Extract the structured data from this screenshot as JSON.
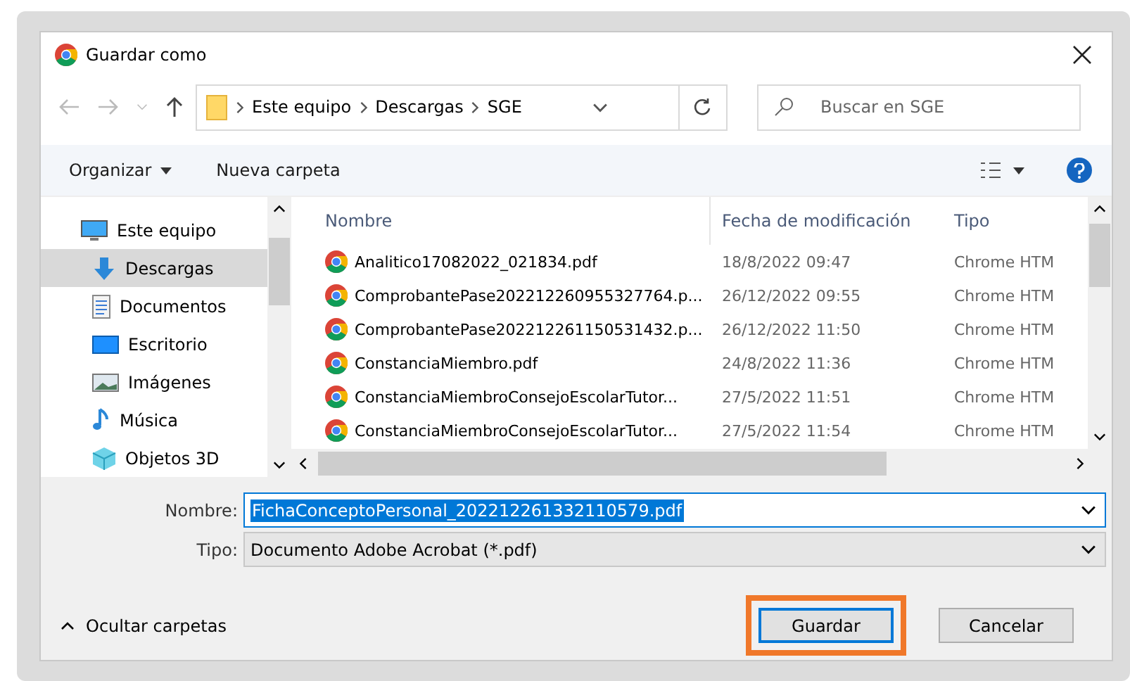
{
  "window": {
    "title": "Guardar como"
  },
  "address": {
    "breadcrumbs": [
      "Este equipo",
      "Descargas",
      "SGE"
    ]
  },
  "search": {
    "placeholder": "Buscar en SGE"
  },
  "toolbar": {
    "organize": "Organizar",
    "new_folder": "Nueva carpeta"
  },
  "sidebar": {
    "items": [
      {
        "label": "Este equipo",
        "kind": "pc",
        "selected": false
      },
      {
        "label": "Descargas",
        "kind": "download",
        "selected": true
      },
      {
        "label": "Documentos",
        "kind": "docs",
        "selected": false
      },
      {
        "label": "Escritorio",
        "kind": "desktop",
        "selected": false
      },
      {
        "label": "Imágenes",
        "kind": "images",
        "selected": false
      },
      {
        "label": "Música",
        "kind": "music",
        "selected": false
      },
      {
        "label": "Objetos 3D",
        "kind": "cube",
        "selected": false
      }
    ]
  },
  "table": {
    "columns": [
      "Nombre",
      "Fecha de modificación",
      "Tipo"
    ],
    "rows": [
      {
        "name": "Analitico17082022_021834.pdf",
        "date": "18/8/2022 09:47",
        "type": "Chrome HTM"
      },
      {
        "name": "ComprobantePase202212260955327764.p...",
        "date": "26/12/2022 09:55",
        "type": "Chrome HTM"
      },
      {
        "name": "ComprobantePase202212261150531432.p...",
        "date": "26/12/2022 11:50",
        "type": "Chrome HTM"
      },
      {
        "name": "ConstanciaMiembro.pdf",
        "date": "24/8/2022 11:36",
        "type": "Chrome HTM"
      },
      {
        "name": "ConstanciaMiembroConsejoEscolarTutor...",
        "date": "27/5/2022 11:51",
        "type": "Chrome HTM"
      },
      {
        "name": "ConstanciaMiembroConsejoEscolarTutor...",
        "date": "27/5/2022 11:54",
        "type": "Chrome HTM"
      }
    ]
  },
  "form": {
    "name_label": "Nombre:",
    "name_value": "FichaConceptoPersonal_202212261332110579.pdf",
    "type_label": "Tipo:",
    "type_value": "Documento Adobe Acrobat (*.pdf)"
  },
  "footer": {
    "hide_folders": "Ocultar carpetas",
    "buttons": [
      {
        "label": "Guardar",
        "primary": true,
        "highlighted": true
      },
      {
        "label": "Cancelar",
        "primary": false,
        "highlighted": false
      }
    ]
  }
}
